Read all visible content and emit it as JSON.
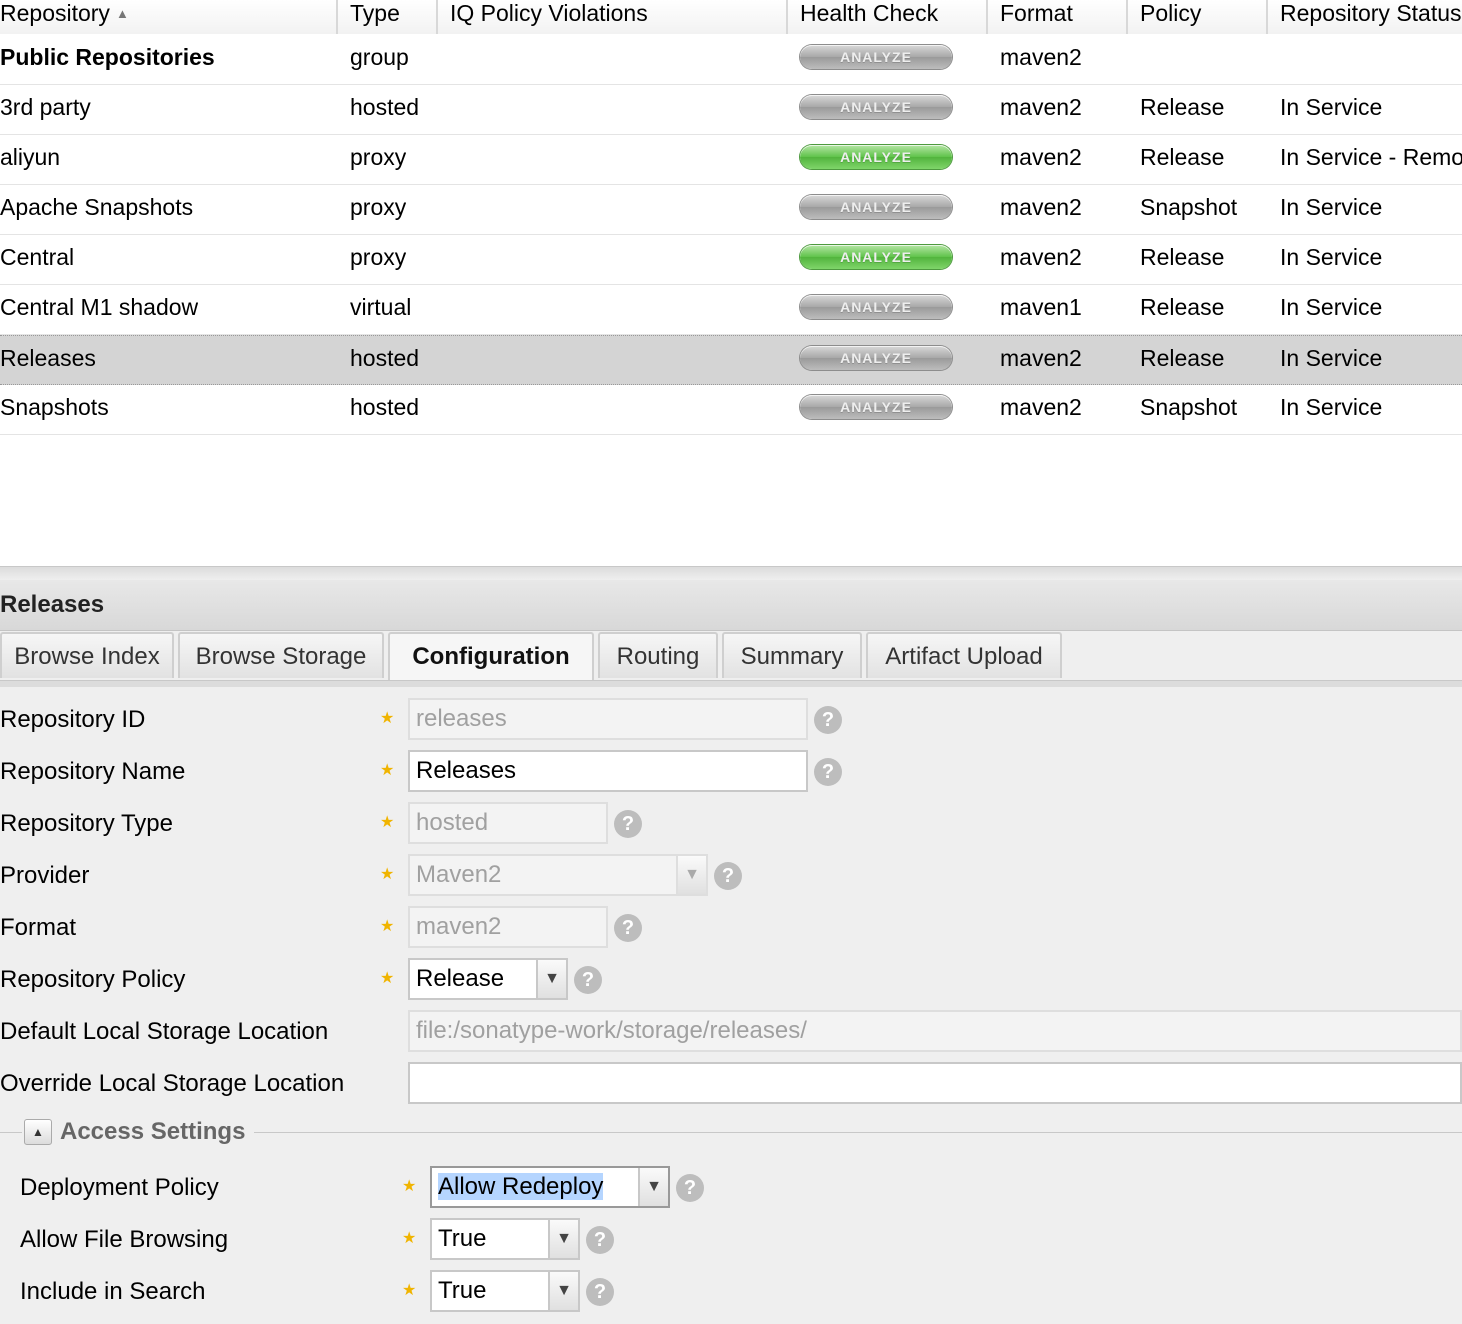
{
  "grid": {
    "columns": [
      {
        "label": "Repository",
        "sorted": "asc"
      },
      {
        "label": "Type"
      },
      {
        "label": "IQ Policy Violations"
      },
      {
        "label": "Health Check"
      },
      {
        "label": "Format"
      },
      {
        "label": "Policy"
      },
      {
        "label": "Repository Status"
      }
    ],
    "rows": [
      {
        "name": "Public Repositories",
        "type": "group",
        "health": "ANALYZE",
        "health_state": "gray",
        "format": "maven2",
        "policy": "",
        "status": "",
        "bold": true
      },
      {
        "name": "3rd party",
        "type": "hosted",
        "health": "ANALYZE",
        "health_state": "gray",
        "format": "maven2",
        "policy": "Release",
        "status": "In Service"
      },
      {
        "name": "aliyun",
        "type": "proxy",
        "health": "ANALYZE",
        "health_state": "green",
        "format": "maven2",
        "policy": "Release",
        "status": "In Service - Remote"
      },
      {
        "name": "Apache Snapshots",
        "type": "proxy",
        "health": "ANALYZE",
        "health_state": "gray",
        "format": "maven2",
        "policy": "Snapshot",
        "status": "In Service"
      },
      {
        "name": "Central",
        "type": "proxy",
        "health": "ANALYZE",
        "health_state": "green",
        "format": "maven2",
        "policy": "Release",
        "status": "In Service"
      },
      {
        "name": "Central M1 shadow",
        "type": "virtual",
        "health": "ANALYZE",
        "health_state": "gray",
        "format": "maven1",
        "policy": "Release",
        "status": "In Service"
      },
      {
        "name": "Releases",
        "type": "hosted",
        "health": "ANALYZE",
        "health_state": "gray",
        "format": "maven2",
        "policy": "Release",
        "status": "In Service",
        "selected": true
      },
      {
        "name": "Snapshots",
        "type": "hosted",
        "health": "ANALYZE",
        "health_state": "gray",
        "format": "maven2",
        "policy": "Snapshot",
        "status": "In Service"
      }
    ]
  },
  "panel": {
    "title": "Releases",
    "tabs": [
      {
        "label": "Browse Index"
      },
      {
        "label": "Browse Storage"
      },
      {
        "label": "Configuration",
        "active": true
      },
      {
        "label": "Routing"
      },
      {
        "label": "Summary"
      },
      {
        "label": "Artifact Upload"
      }
    ],
    "fields": {
      "repo_id": {
        "label": "Repository ID",
        "value": "releases"
      },
      "repo_name": {
        "label": "Repository Name",
        "value": "Releases"
      },
      "repo_type": {
        "label": "Repository Type",
        "value": "hosted"
      },
      "provider": {
        "label": "Provider",
        "value": "Maven2"
      },
      "format": {
        "label": "Format",
        "value": "maven2"
      },
      "repo_policy": {
        "label": "Repository Policy",
        "value": "Release"
      },
      "default_storage": {
        "label": "Default Local Storage Location",
        "value": "file:/sonatype-work/storage/releases/"
      },
      "override_storage": {
        "label": "Override Local Storage Location",
        "value": ""
      }
    },
    "access": {
      "title": "Access Settings",
      "deployment_policy": {
        "label": "Deployment Policy",
        "value": "Allow Redeploy"
      },
      "file_browsing": {
        "label": "Allow File Browsing",
        "value": "True"
      },
      "include_search": {
        "label": "Include in Search",
        "value": "True"
      }
    }
  },
  "icons": {
    "star": "required-star-icon",
    "help": "help-icon",
    "dropdown": "chevron-down-icon",
    "collapse": "collapse-up-icon",
    "sort": "sort-asc-icon"
  },
  "colors": {
    "selected_row": "#d4d4d4",
    "analyze_gray": "#a8a8a8",
    "analyze_green": "#5fc34a",
    "star": "#f0b400",
    "text_highlight": "#b5d5ff"
  }
}
